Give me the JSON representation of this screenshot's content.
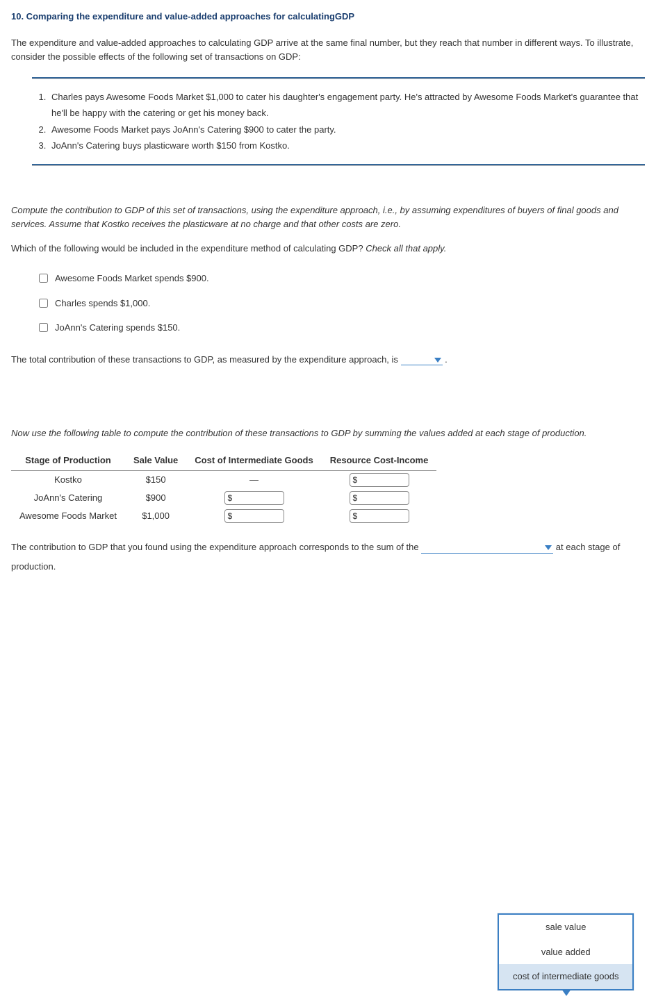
{
  "heading": "10. Comparing the expenditure and value-added approaches for calculatingGDP",
  "intro": "The expenditure and value-added approaches to calculating GDP arrive at the same final number, but they reach that number in different ways. To illustrate, consider the possible effects of the following set of transactions on GDP:",
  "transactions": [
    "Charles pays Awesome Foods Market $1,000 to cater his daughter's engagement party. He's attracted by Awesome Foods Market's guarantee that he'll be happy with the catering or get his money back.",
    "Awesome Foods Market pays JoAnn's Catering $900 to cater the party.",
    "JoAnn's Catering buys plasticware worth $150 from Kostko."
  ],
  "compute_prompt": "Compute the contribution to GDP of this set of transactions, using the expenditure approach, i.e., by assuming expenditures of buyers of final goods and services. Assume that Kostko receives the plasticware at no charge and that other costs are zero.",
  "check_prompt": "Which of the following would be included in the expenditure method of calculating GDP? ",
  "check_hint": "Check all that apply.",
  "checkboxes": [
    "Awesome Foods Market spends $900.",
    "Charles spends $1,000.",
    "JoAnn's Catering spends $150."
  ],
  "total_sentence_a": "The total contribution of these transactions to GDP, as measured by the expenditure approach, is ",
  "total_sentence_b": " .",
  "table_prompt": "Now use the following table to compute the contribution of these transactions to GDP by summing the values added at each stage of production.",
  "table": {
    "headers": [
      "Stage of Production",
      "Sale Value",
      "Cost of Intermediate Goods",
      "Resource Cost-Income"
    ],
    "rows": [
      {
        "stage": "Kostko",
        "sale": "$150",
        "cost_intermediate": "—",
        "resource_input": true
      },
      {
        "stage": "JoAnn's Catering",
        "sale": "$900",
        "cost_input": true,
        "resource_input": true
      },
      {
        "stage": "Awesome Foods Market",
        "sale": "$1,000",
        "cost_input": true,
        "resource_input": true
      }
    ]
  },
  "dropdown_options": [
    "sale value",
    "value added",
    "cost of intermediate goods"
  ],
  "final_sentence_a": "The contribution to GDP that you found using the expenditure approach corresponds to the sum of the ",
  "final_sentence_b": " at each stage of production.",
  "dollar_sign": "$"
}
